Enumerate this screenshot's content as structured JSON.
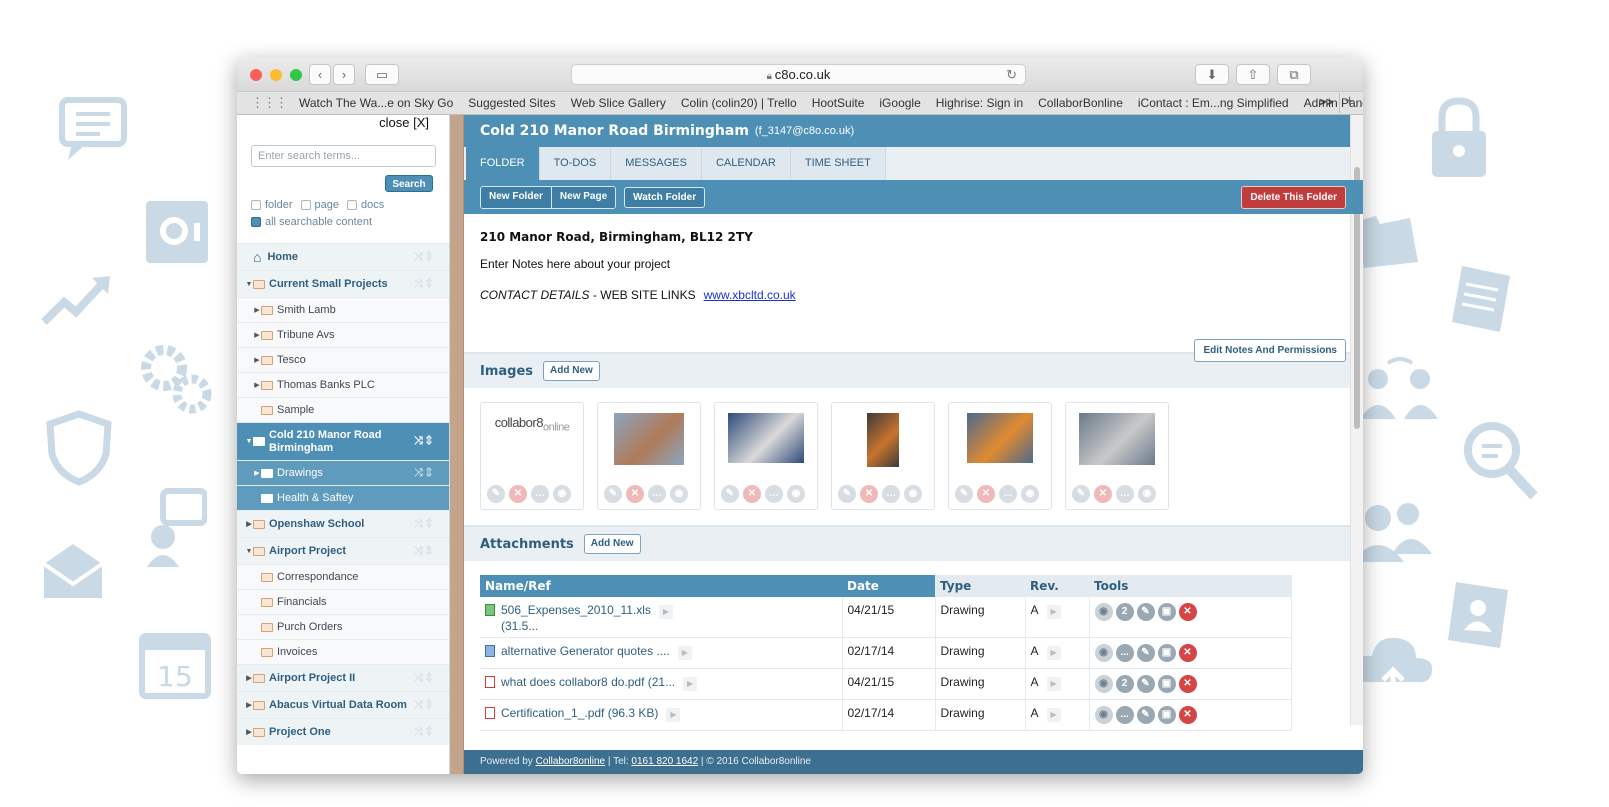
{
  "browser": {
    "url": "c8o.co.uk",
    "bookmarks": [
      "Watch The Wa...e on Sky Go",
      "Suggested Sites",
      "Web Slice Gallery",
      "Colin (colin20) | Trello",
      "HootSuite",
      "iGoogle",
      "Highrise: Sign in",
      "CollaborBonline",
      "iContact : Em...ng Simplified",
      "Admin Panel"
    ],
    "more": ">>"
  },
  "sidebar": {
    "close": "close [X]",
    "search_placeholder": "Enter search terms...",
    "search_button": "Search",
    "filters": {
      "folder": "folder",
      "page": "page",
      "docs": "docs",
      "all": "all searchable content"
    },
    "tree": [
      {
        "label": "Home",
        "level": "top",
        "icon": "home-icon"
      },
      {
        "label": "Current Small Projects",
        "level": "top",
        "expanded": true
      },
      {
        "label": "Smith Lamb",
        "level": "sub"
      },
      {
        "label": "Tribune Avs",
        "level": "sub"
      },
      {
        "label": "Tesco",
        "level": "sub"
      },
      {
        "label": "Thomas Banks PLC",
        "level": "sub"
      },
      {
        "label": "Sample",
        "level": "sub"
      },
      {
        "label": "Cold 210 Manor Road Birmingham",
        "level": "active"
      },
      {
        "label": "Drawings",
        "level": "active-sub"
      },
      {
        "label": "Health & Saftey",
        "level": "active-sub"
      },
      {
        "label": "Openshaw School",
        "level": "top"
      },
      {
        "label": "Airport Project",
        "level": "top",
        "expanded": true
      },
      {
        "label": "Correspondance",
        "level": "sub"
      },
      {
        "label": "Financials",
        "level": "sub"
      },
      {
        "label": "Purch Orders",
        "level": "sub"
      },
      {
        "label": "Invoices",
        "level": "sub"
      },
      {
        "label": "Airport Project II",
        "level": "top"
      },
      {
        "label": "Abacus Virtual Data Room",
        "level": "top"
      },
      {
        "label": "Project One",
        "level": "top"
      }
    ]
  },
  "header": {
    "title": "Cold 210 Manor Road Birmingham",
    "email": "(f_3147@c8o.co.uk)"
  },
  "tabs": [
    "FOLDER",
    "TO-DOS",
    "MESSAGES",
    "CALENDAR",
    "TIME SHEET"
  ],
  "toolbar": {
    "new_folder": "New Folder",
    "new_page": "New Page",
    "watch_folder": "Watch Folder",
    "delete_folder": "Delete This Folder"
  },
  "notes": {
    "address": "210 Manor Road, Birmingham, BL12 2TY",
    "text": "Enter Notes here about your project",
    "contact_label": "CONTACT DETAILS",
    "contact_sep": " - WEB SITE LINKS",
    "link": "www.xbcltd.co.uk",
    "edit_button": "Edit Notes And Permissions"
  },
  "images": {
    "heading": "Images",
    "add_new": "Add New",
    "logo_text": "collabor8",
    "logo_sub": "online"
  },
  "attachments": {
    "heading": "Attachments",
    "add_new": "Add New",
    "columns": [
      "Name/Ref",
      "Date",
      "Type",
      "Rev.",
      "Tools"
    ],
    "rows": [
      {
        "name": "506_Expenses_2010_11.xls",
        "size": "(31.5...",
        "date": "04/21/15",
        "type": "Drawing",
        "rev": "A",
        "file": "xls",
        "badge": "2"
      },
      {
        "name": "alternative Generator quotes ....",
        "size": "",
        "date": "02/17/14",
        "type": "Drawing",
        "rev": "A",
        "file": "doc",
        "badge": "..."
      },
      {
        "name": "what does collabor8 do.pdf (21...",
        "size": "",
        "date": "04/21/15",
        "type": "Drawing",
        "rev": "A",
        "file": "pdf",
        "badge": "2"
      },
      {
        "name": "Certification_1_.pdf (96.3 KB)",
        "size": "",
        "date": "02/17/14",
        "type": "Drawing",
        "rev": "A",
        "file": "pdf",
        "badge": "..."
      }
    ]
  },
  "footer": {
    "powered": "Powered by ",
    "brand": "Collabor8online",
    "tel_label": " | Tel: ",
    "tel": "0161 820 1642",
    "copy": " | © 2016 Collabor8online"
  },
  "colors": {
    "primary": "#4d8fb5",
    "danger": "#c13c3c",
    "splitter": "#c4a58c"
  }
}
